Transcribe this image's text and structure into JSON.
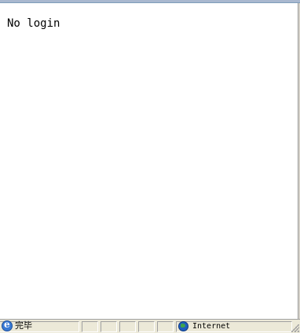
{
  "page": {
    "body_text": "No login"
  },
  "statusbar": {
    "status": "完毕",
    "zone": "Internet",
    "icons": {
      "status_icon": "ie-page-icon",
      "zone_icon": "internet-globe-icon",
      "resize": "resize-grip-icon"
    }
  }
}
